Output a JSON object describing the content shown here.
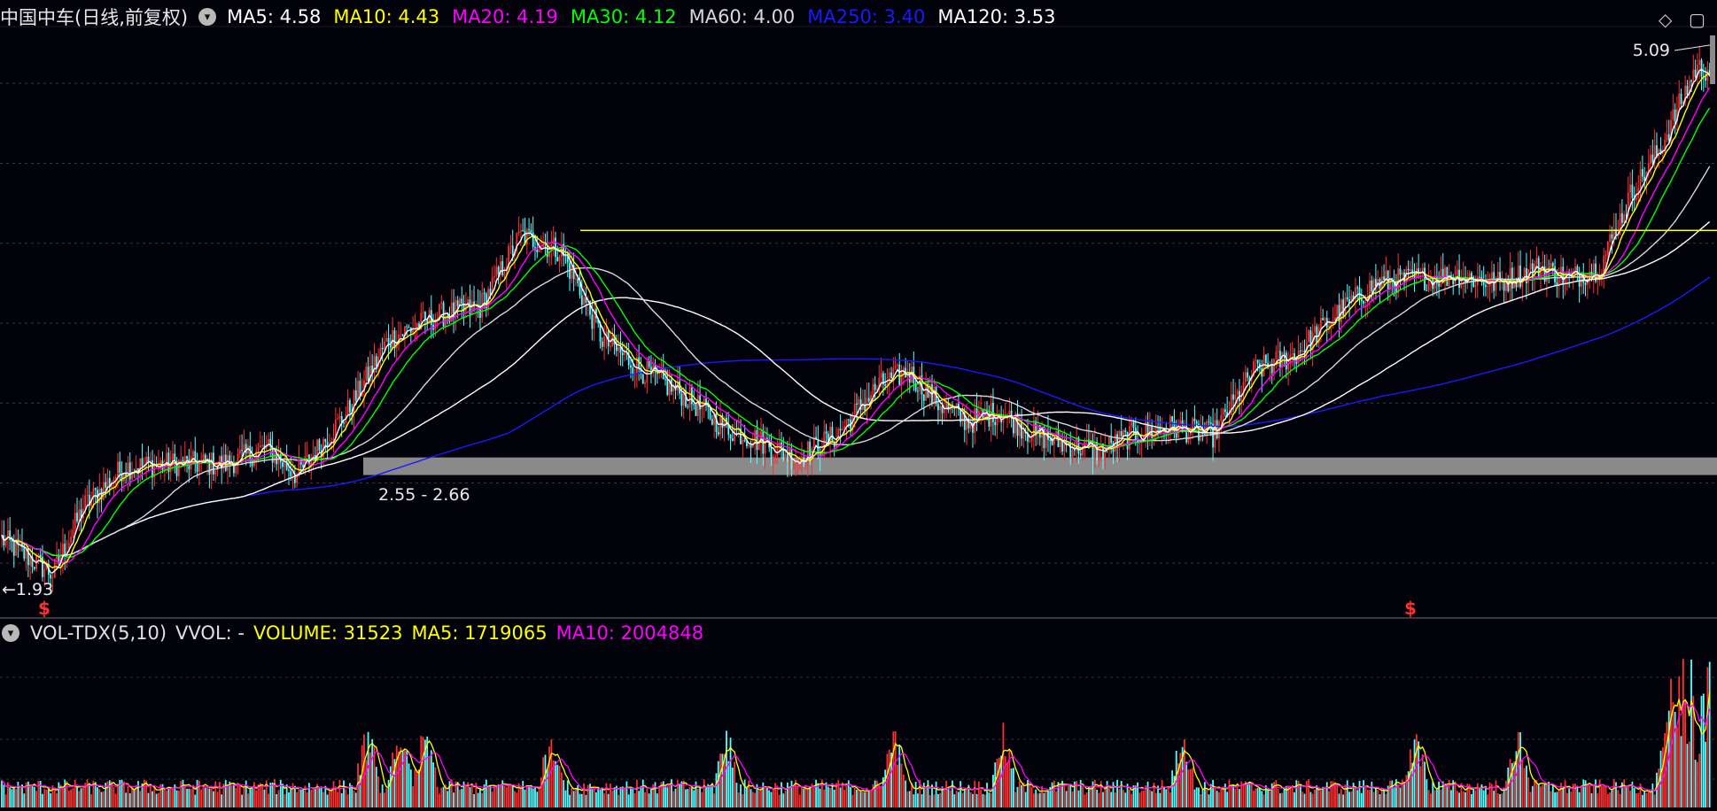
{
  "header": {
    "title": "中国中车(日线,前复权)",
    "ma_legend": [
      {
        "label": "MA5: 4.58",
        "color": "#ffffff"
      },
      {
        "label": "MA10: 4.43",
        "color": "#ffff00"
      },
      {
        "label": "MA20: 4.19",
        "color": "#ff00ff"
      },
      {
        "label": "MA30: 4.12",
        "color": "#00ff00"
      },
      {
        "label": "MA60: 4.00",
        "color": "#d8d8d8"
      },
      {
        "label": "MA250: 3.40",
        "color": "#1a1aff"
      },
      {
        "label": "MA120: 3.53",
        "color": "#ffffff"
      }
    ]
  },
  "volume_header": {
    "title": "VOL-TDX(5,10)",
    "vvol": "VVOL: -",
    "volume": "VOLUME: 31523",
    "ma5": "MA5: 1719065",
    "ma10": "MA10: 2004848"
  },
  "icons": {
    "collapse": "chevron-down-icon",
    "diamond": "diamond-icon",
    "window": "window-icon"
  },
  "colors": {
    "up": "#ff3030",
    "down": "#54ffff",
    "ma5": "#ffffff",
    "ma10": "#ffff00",
    "ma20": "#ff00ff",
    "ma30": "#00ff00",
    "ma60": "#d8d8d8",
    "ma120": "#ffffff",
    "ma250": "#1a1aff",
    "resistance": "#ffff00",
    "band": "#8a8a8a",
    "marker": "#ff3030"
  },
  "chart_data": {
    "type": "candlestick",
    "price_range": [
      1.7,
      5.3
    ],
    "annotations": {
      "high_label": "5.09",
      "low_label": "←1.93",
      "band_label": "2.55 - 2.66",
      "band_range": [
        2.55,
        2.66
      ],
      "resistance_level": 4.08,
      "signal_marker": "$"
    },
    "price_path_anchors": [
      [
        0,
        2.15
      ],
      [
        25,
        1.93
      ],
      [
        40,
        2.35
      ],
      [
        60,
        2.6
      ],
      [
        85,
        2.62
      ],
      [
        110,
        2.62
      ],
      [
        130,
        2.72
      ],
      [
        145,
        2.55
      ],
      [
        170,
        2.95
      ],
      [
        190,
        3.4
      ],
      [
        215,
        3.55
      ],
      [
        235,
        3.6
      ],
      [
        255,
        4.05
      ],
      [
        275,
        3.95
      ],
      [
        295,
        3.4
      ],
      [
        315,
        3.2
      ],
      [
        335,
        3.05
      ],
      [
        355,
        2.85
      ],
      [
        375,
        2.75
      ],
      [
        390,
        2.65
      ],
      [
        410,
        2.8
      ],
      [
        430,
        3.1
      ],
      [
        445,
        3.2
      ],
      [
        460,
        3.0
      ],
      [
        475,
        2.88
      ],
      [
        490,
        2.95
      ],
      [
        505,
        2.82
      ],
      [
        520,
        2.75
      ],
      [
        540,
        2.7
      ],
      [
        555,
        2.8
      ],
      [
        575,
        2.85
      ],
      [
        595,
        2.8
      ],
      [
        615,
        3.2
      ],
      [
        635,
        3.3
      ],
      [
        655,
        3.55
      ],
      [
        675,
        3.75
      ],
      [
        695,
        3.78
      ],
      [
        715,
        3.8
      ],
      [
        735,
        3.75
      ],
      [
        755,
        3.85
      ],
      [
        770,
        3.78
      ],
      [
        785,
        3.85
      ],
      [
        800,
        4.3
      ],
      [
        815,
        4.6
      ],
      [
        832,
        5.09
      ]
    ],
    "volume": {
      "labels": [
        "VOLUME: 31523",
        "MA5: 1719065",
        "MA10: 2004848"
      ],
      "spike_indices": [
        180,
        196,
        208,
        270,
        356,
        438,
        492,
        580,
        695,
        745,
        818,
        826
      ]
    }
  }
}
